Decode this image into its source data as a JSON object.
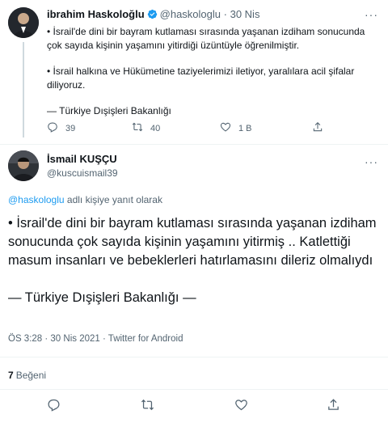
{
  "parent_tweet": {
    "display_name": "ibrahim Haskoloğlu",
    "handle": "@haskologlu",
    "separator": "·",
    "date": "30 Nis",
    "more_label": "···",
    "paragraphs": [
      "• İsrail'de dini bir bayram kutlaması sırasında yaşanan izdiham sonucunda çok sayıda kişinin yaşamını yitirdiği üzüntüyle öğrenilmiştir.",
      "• İsrail halkına ve Hükümetine taziyelerimizi iletiyor, yaralılara acil şifalar diliyoruz.",
      "— Türkiye Dışişleri Bakanlığı"
    ],
    "actions": {
      "reply_count": "39",
      "retweet_count": "40",
      "like_count": "1 B"
    }
  },
  "reply_tweet": {
    "display_name": "İsmail KUŞÇU",
    "handle": "@kuscuismail39",
    "more_label": "···",
    "reply_to_link": "@haskologlu",
    "reply_to_suffix": "adlı kişiye yanıt olarak",
    "paragraphs": [
      "• İsrail'de dini bir bayram kutlaması sırasında yaşanan izdiham sonucunda çok sayıda kişinin yaşamını yitirmiş .. Katlettiği masum insanları ve bebeklerleri hatırlamasını dileriz olmalıydı",
      "— Türkiye Dışişleri Bakanlığı —"
    ],
    "meta": "ÖS 3:28 · 30 Nis 2021 · Twitter for Android",
    "likes_count": "7",
    "likes_label": "Beğeni"
  },
  "colors": {
    "link": "#1d9bf0",
    "muted": "#536471",
    "divider": "#eff3f4"
  },
  "icons": [
    "avatar",
    "verified-badge-icon",
    "reply-icon",
    "retweet-icon",
    "like-icon",
    "share-icon",
    "more-icon"
  ]
}
